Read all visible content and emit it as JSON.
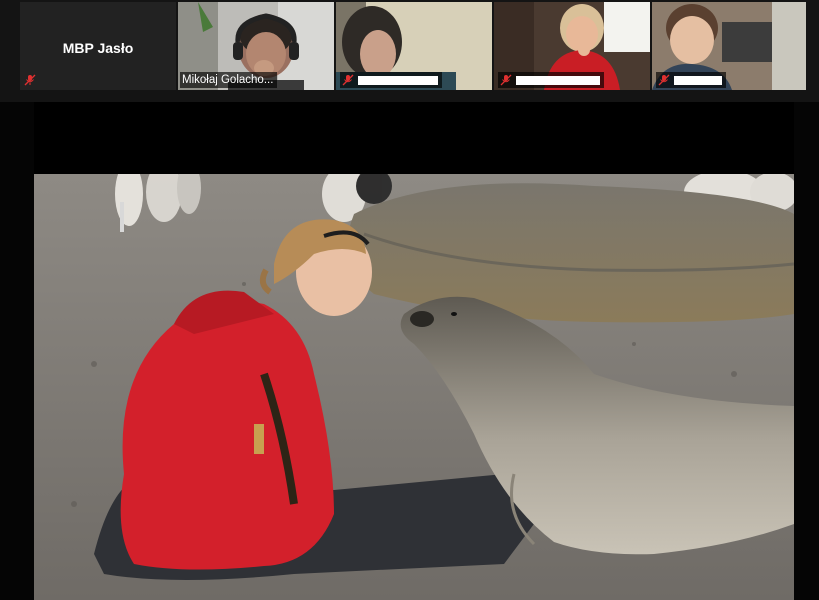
{
  "participants": [
    {
      "name": "MBP Jasło",
      "muted": true,
      "video": false
    },
    {
      "name": "Mikołaj Golacho...",
      "muted": false,
      "video": true
    },
    {
      "name": "",
      "muted": true,
      "video": true,
      "name_redacted": true
    },
    {
      "name": "",
      "muted": true,
      "video": true,
      "name_redacted": true
    },
    {
      "name": "",
      "muted": true,
      "video": true,
      "name_redacted": true
    }
  ],
  "shared_screen": {
    "content": "video-frame",
    "colors": {
      "sand": "#8a857e",
      "jacket": "#d4202a",
      "seal": "#9a948a"
    }
  },
  "icons": {
    "muted": "mic-muted-icon"
  }
}
